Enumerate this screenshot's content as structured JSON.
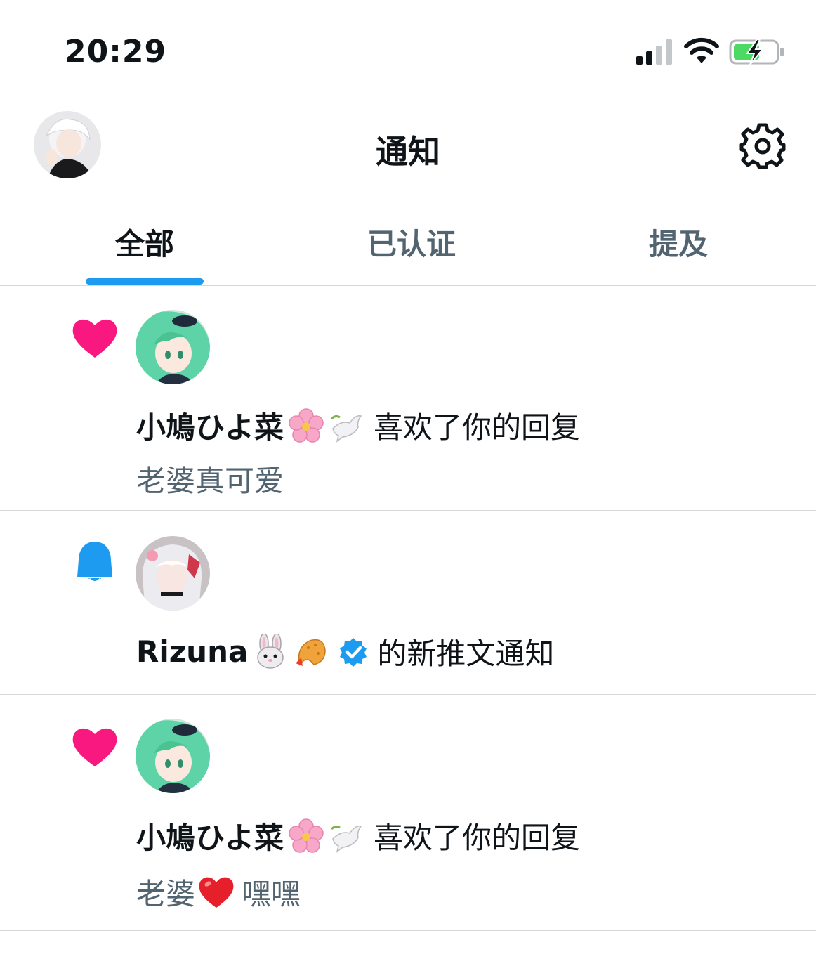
{
  "status_bar": {
    "time": "20:29",
    "battery_color": "#4cd964"
  },
  "header": {
    "title": "通知",
    "avatar_icon": "user-avatar",
    "settings_icon": "gear-icon"
  },
  "tabs": [
    {
      "label": "全部",
      "active": true
    },
    {
      "label": "已认证",
      "active": false
    },
    {
      "label": "提及",
      "active": false
    }
  ],
  "accent_color": "#1d9bf0",
  "like_color": "#f91880",
  "notifications": [
    {
      "type": "like",
      "icon": "heart-icon",
      "name": "小鳩ひよ菜",
      "name_emoji": [
        "cherry-blossom",
        "dove"
      ],
      "action": "喜欢了你的回复",
      "preview": "老婆真可爱"
    },
    {
      "type": "tweet-notify",
      "icon": "bell-icon",
      "name": "Rizuna",
      "name_emoji": [
        "rabbit-face",
        "fried-shrimp"
      ],
      "verified": true,
      "action": "的新推文通知"
    },
    {
      "type": "like",
      "icon": "heart-icon",
      "name": "小鳩ひよ菜",
      "name_emoji": [
        "cherry-blossom",
        "dove"
      ],
      "action": "喜欢了你的回复",
      "preview_before": "老婆",
      "preview_emoji": "red-heart",
      "preview_after": "嘿嘿"
    }
  ]
}
